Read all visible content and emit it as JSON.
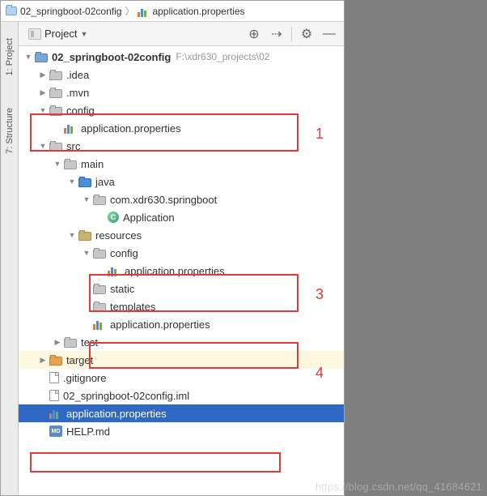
{
  "breadcrumb": {
    "root": "02_springboot-02config",
    "file": "application.properties"
  },
  "sidebar_rails": {
    "project": "1: Project",
    "structure": "7: Structure"
  },
  "toolbar": {
    "view_label": "Project",
    "dropdown_glyph": "▼",
    "locate_glyph": "⊕",
    "collapse_glyph": "⇢",
    "settings_glyph": "⚙",
    "hide_glyph": "—"
  },
  "tree": {
    "project": {
      "name": "02_springboot-02config",
      "hint": "F:\\xdr630_projects\\02"
    },
    "idea": ".idea",
    "mvn": ".mvn",
    "config": "config",
    "config_props": "application.properties",
    "src": "src",
    "main": "main",
    "java": "java",
    "package": "com.xdr630.springboot",
    "app_class": "Application",
    "resources": "resources",
    "res_config": "config",
    "res_config_props": "application.properties",
    "static": "static",
    "templates": "templates",
    "res_props": "application.properties",
    "test": "test",
    "target": "target",
    "gitignore": ".gitignore",
    "iml": "02_springboot-02config.iml",
    "root_props": "application.properties",
    "help": "HELP.md",
    "md_badge": "MD"
  },
  "arrows": {
    "open": "▼",
    "closed": "▶"
  },
  "class_badge": "C",
  "annotations": {
    "a1": "1",
    "a3": "3",
    "a4": "4"
  },
  "watermark": "https://blog.csdn.net/qq_41684621"
}
